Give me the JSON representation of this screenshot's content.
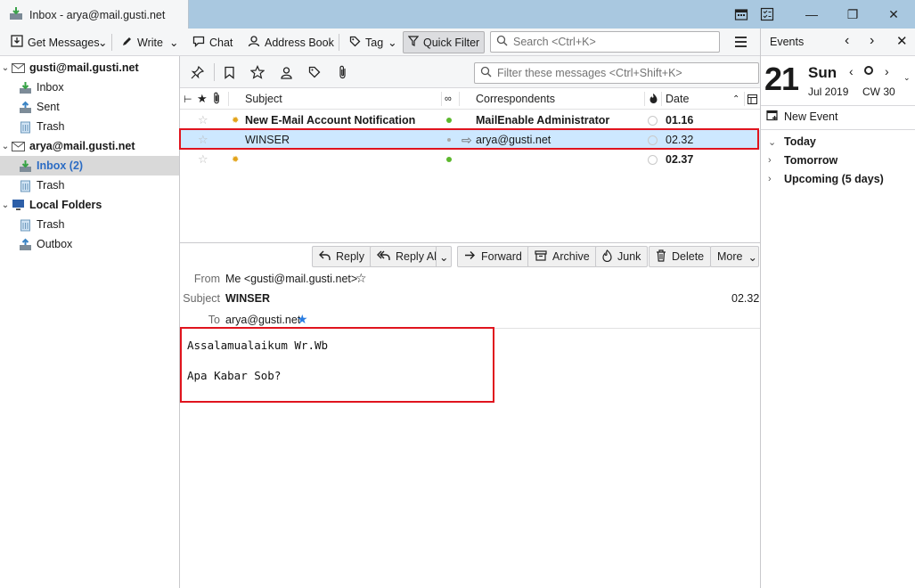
{
  "window": {
    "tab_title": "Inbox - arya@mail.gusti.net",
    "controls": [
      "—",
      "❐",
      "✕"
    ]
  },
  "toolbar": {
    "get_messages": "Get Messages",
    "write": "Write",
    "chat": "Chat",
    "address_book": "Address Book",
    "tag": "Tag",
    "quick_filter": "Quick Filter",
    "search_placeholder": "Search <Ctrl+K>"
  },
  "folders": {
    "accounts": [
      {
        "name": "gusti@mail.gusti.net",
        "folders": [
          "Inbox",
          "Sent",
          "Trash"
        ]
      },
      {
        "name": "arya@mail.gusti.net",
        "folders": [
          "Inbox (2)",
          "Trash"
        ]
      },
      {
        "name": "Local Folders",
        "folders": [
          "Trash",
          "Outbox"
        ]
      }
    ]
  },
  "quickfilter": {
    "filter_placeholder": "Filter these messages <Ctrl+Shift+K>"
  },
  "thread": {
    "columns": {
      "subject": "Subject",
      "correspondents": "Correspondents",
      "date": "Date"
    },
    "rows": [
      {
        "subject": "New E-Mail Account Notification",
        "correspondent": "MailEnable Administrator",
        "date": "01.16",
        "unread": true,
        "selected": false
      },
      {
        "subject": "WINSER",
        "correspondent": "arya@gusti.net",
        "date": "02.32",
        "unread": false,
        "selected": true
      },
      {
        "subject": "",
        "correspondent": "",
        "date": "02.37",
        "unread": true,
        "selected": false
      }
    ]
  },
  "message": {
    "actions": {
      "reply": "Reply",
      "reply_all": "Reply All",
      "forward": "Forward",
      "archive": "Archive",
      "junk": "Junk",
      "delete": "Delete",
      "more": "More"
    },
    "labels": {
      "from": "From",
      "subject": "Subject",
      "to": "To"
    },
    "from": "Me <gusti@mail.gusti.net>",
    "subject": "WINSER",
    "time": "02.32",
    "to": "arya@gusti.net",
    "body": [
      "Assalamualaikum Wr.Wb",
      "Apa Kabar Sob?"
    ]
  },
  "events": {
    "title": "Events",
    "day_number": "21",
    "weekday": "Sun",
    "month_year": "Jul 2019",
    "week": "CW 30",
    "new_event": "New Event",
    "groups": [
      "Today",
      "Tomorrow",
      "Upcoming (5 days)"
    ]
  },
  "colors": {
    "selection": "#cde8ff",
    "highlight_box": "#e0141e",
    "folder_selected": "#d9d9d9",
    "tabbar": "#a9c8e0"
  }
}
